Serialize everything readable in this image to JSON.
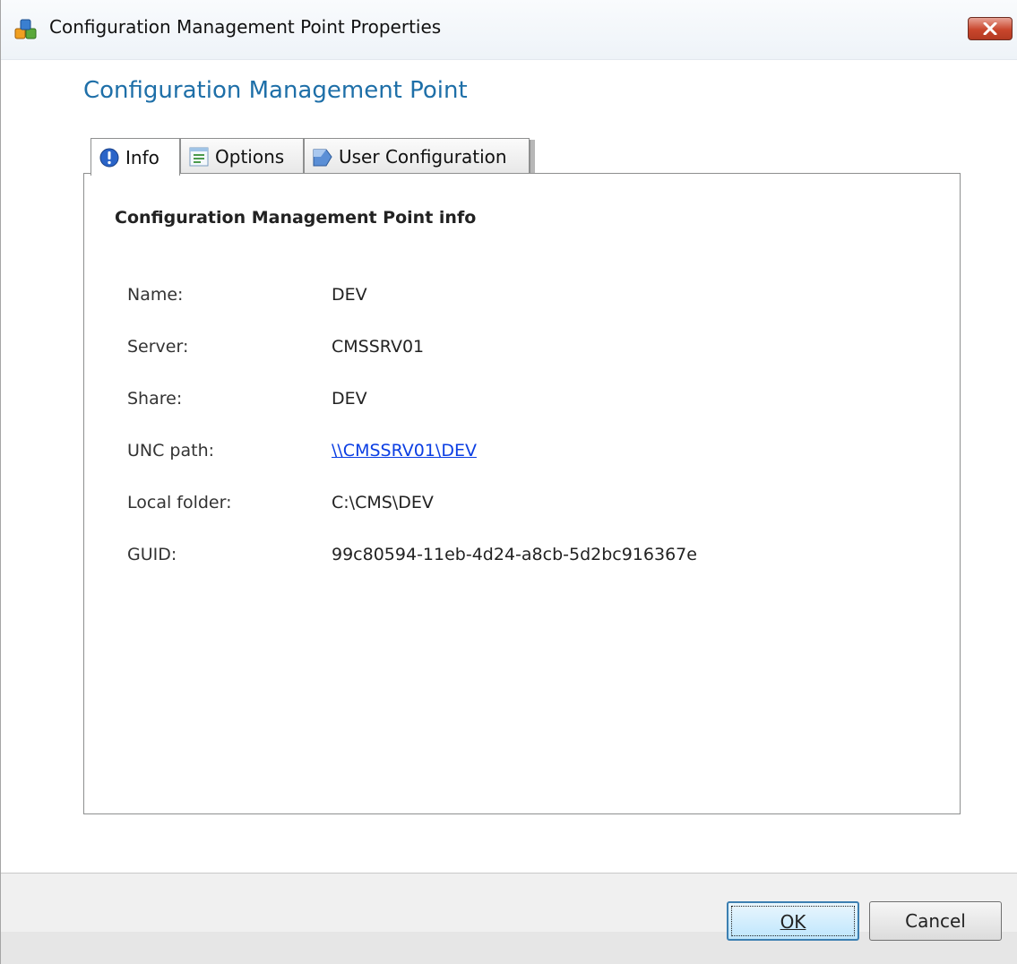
{
  "window": {
    "title": "Configuration Management Point Properties",
    "icon": "app-icon"
  },
  "heading": "Configuration Management Point",
  "tabs": [
    {
      "label": "Info",
      "icon": "info-icon",
      "active": true
    },
    {
      "label": "Options",
      "icon": "options-icon",
      "active": false
    },
    {
      "label": "User Configuration",
      "icon": "user-configuration-icon",
      "active": false
    }
  ],
  "info": {
    "section_title": "Configuration Management Point info",
    "fields": [
      {
        "label": "Name:",
        "value": "DEV"
      },
      {
        "label": "Server:",
        "value": "CMSSRV01"
      },
      {
        "label": "Share:",
        "value": "DEV"
      },
      {
        "label": "UNC path:",
        "value": "\\\\CMSSRV01\\DEV"
      },
      {
        "label": "Local folder:",
        "value": "C:\\CMS\\DEV"
      },
      {
        "label": "GUID:",
        "value": "99c80594-11eb-4d24-a8cb-5d2bc916367e"
      }
    ]
  },
  "buttons": {
    "ok": "OK",
    "cancel": "Cancel"
  },
  "colors": {
    "heading": "#1e6fa8",
    "link": "#0b3ee3",
    "close_button": "#c9462c"
  }
}
